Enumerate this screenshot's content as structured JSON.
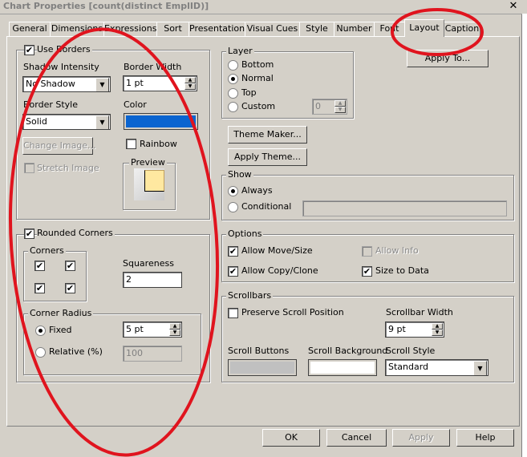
{
  "title": "Chart Properties [count(distinct EmplID)]",
  "tabs": [
    "General",
    "Dimensions",
    "Expressions",
    "Sort",
    "Presentation",
    "Visual Cues",
    "Style",
    "Number",
    "Font",
    "Layout",
    "Caption"
  ],
  "active_tab": "Layout",
  "borders": {
    "use_borders": "Use Borders",
    "shadow_intensity_label": "Shadow Intensity",
    "shadow_intensity_value": "No Shadow",
    "border_width_label": "Border Width",
    "border_width_value": "1 pt",
    "border_style_label": "Border Style",
    "border_style_value": "Solid",
    "color_label": "Color",
    "color_value": "#0a64d0",
    "rainbow_label": "Rainbow",
    "change_image_label": "Change Image...",
    "stretch_image_label": "Stretch Image",
    "preview_label": "Preview"
  },
  "rounded": {
    "rounded_corners_label": "Rounded Corners",
    "corners_label": "Corners",
    "squareness_label": "Squareness",
    "squareness_value": "2",
    "corner_radius_label": "Corner Radius",
    "fixed_label": "Fixed",
    "fixed_value": "5 pt",
    "relative_label": "Relative (%)",
    "relative_value": "100"
  },
  "layer": {
    "label": "Layer",
    "options": [
      "Bottom",
      "Normal",
      "Top",
      "Custom"
    ],
    "custom_value": "0"
  },
  "apply_to_label": "Apply To...",
  "theme_maker_label": "Theme Maker...",
  "apply_theme_label": "Apply Theme...",
  "show": {
    "label": "Show",
    "always": "Always",
    "conditional": "Conditional"
  },
  "options": {
    "label": "Options",
    "allow_move": "Allow Move/Size",
    "allow_info": "Allow Info",
    "allow_copy": "Allow Copy/Clone",
    "size_to_data": "Size to Data"
  },
  "scrollbars": {
    "label": "Scrollbars",
    "preserve": "Preserve Scroll Position",
    "scrollbar_width_label": "Scrollbar Width",
    "scrollbar_width_value": "9 pt",
    "scroll_buttons_label": "Scroll Buttons",
    "scroll_background_label": "Scroll Background",
    "scroll_style_label": "Scroll Style",
    "scroll_style_value": "Standard"
  },
  "buttons": {
    "ok": "OK",
    "cancel": "Cancel",
    "apply": "Apply",
    "help": "Help"
  },
  "annotation_color": "#e0141e"
}
